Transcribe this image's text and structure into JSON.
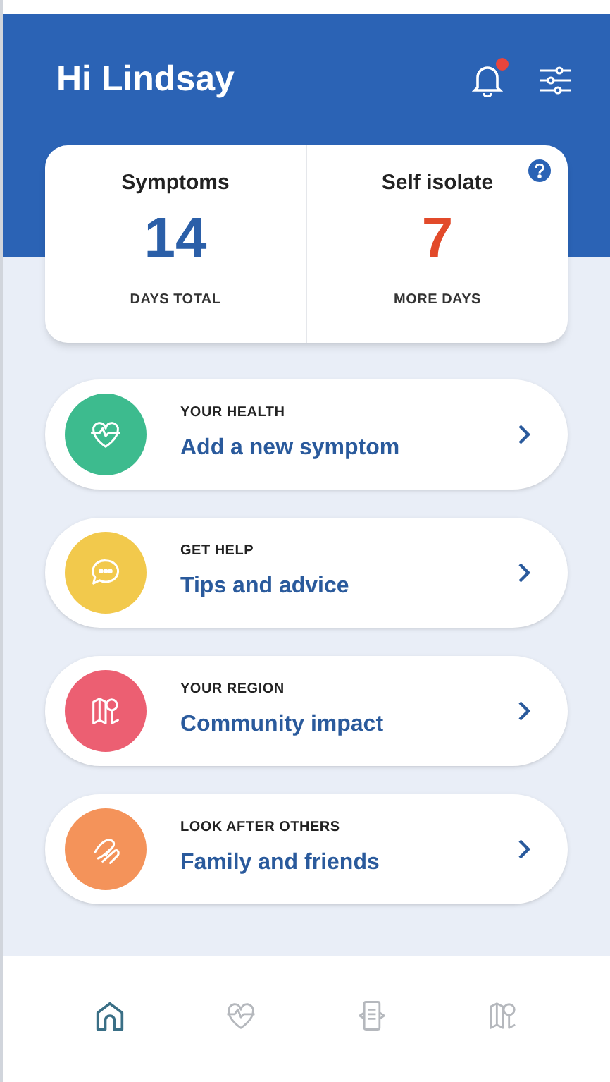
{
  "header": {
    "greeting": "Hi Lindsay",
    "has_notification": true
  },
  "stats": [
    {
      "title": "Symptoms",
      "value": "14",
      "caption": "DAYS TOTAL",
      "color": "#2b5fa8"
    },
    {
      "title": "Self isolate",
      "value": "7",
      "caption": "MORE DAYS",
      "color": "#e24a2a"
    }
  ],
  "cards": [
    {
      "kind": "heart",
      "eyebrow": "YOUR HEALTH",
      "title": "Add a new symptom",
      "color": "#3dbb8e"
    },
    {
      "kind": "chat",
      "eyebrow": "GET HELP",
      "title": "Tips and advice",
      "color": "#f2c94c"
    },
    {
      "kind": "map",
      "eyebrow": "YOUR REGION",
      "title": "Community impact",
      "color": "#ec5f72"
    },
    {
      "kind": "hands",
      "eyebrow": "LOOK AFTER OTHERS",
      "title": "Family and friends",
      "color": "#f4935a"
    }
  ],
  "nav": [
    {
      "kind": "home",
      "selected": true
    },
    {
      "kind": "heart",
      "selected": false
    },
    {
      "kind": "document",
      "selected": false
    },
    {
      "kind": "map",
      "selected": false
    }
  ]
}
